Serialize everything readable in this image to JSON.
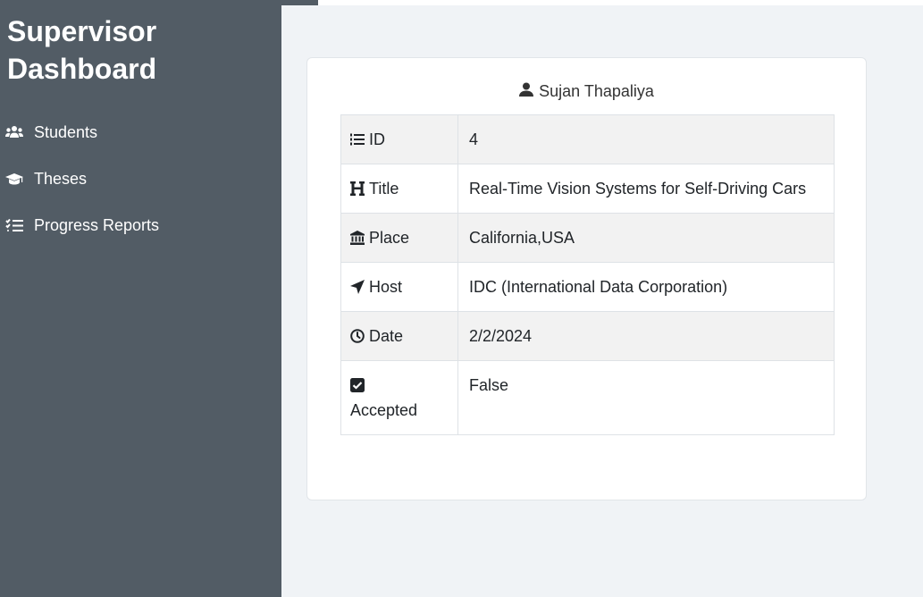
{
  "sidebar": {
    "title": "Supervisor\nDashboard",
    "items": [
      {
        "label": "Students",
        "icon": "users-icon"
      },
      {
        "label": "Theses",
        "icon": "graduation-cap-icon"
      },
      {
        "label": "Progress Reports",
        "icon": "list-check-icon"
      }
    ],
    "toggle_icon": "hamburger-icon"
  },
  "card": {
    "header_icon": "user-icon",
    "student_name": "Sujan Thapaliya",
    "rows": [
      {
        "icon": "list-ol-icon",
        "label": "ID",
        "value": "4"
      },
      {
        "icon": "heading-icon",
        "label": "Title",
        "value": "Real-Time Vision Systems for Self-Driving Cars"
      },
      {
        "icon": "building-columns-icon",
        "label": "Place",
        "value": "California,USA"
      },
      {
        "icon": "location-arrow-icon",
        "label": "Host",
        "value": "IDC (International Data Corporation)"
      },
      {
        "icon": "clock-icon",
        "label": "Date",
        "value": "2/2/2024"
      },
      {
        "icon": "checkbox-icon",
        "label": "Accepted",
        "value": "False"
      }
    ]
  },
  "colors": {
    "sidebar_bg": "#525c65",
    "main_bg": "#f0f3f6",
    "stripe_bg": "#f2f2f2"
  }
}
